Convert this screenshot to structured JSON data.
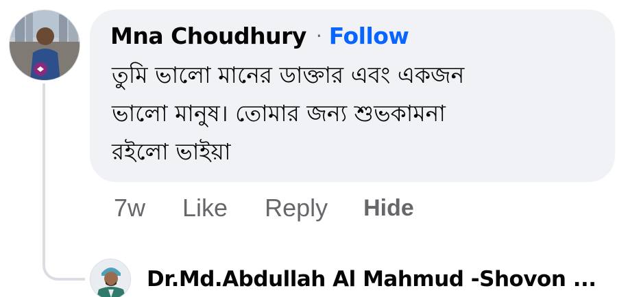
{
  "comment": {
    "author": "Mna Choudhury",
    "separator": "·",
    "follow_label": "Follow",
    "text_lines": [
      "তুমি ভালো মানের ডাক্তার এবং একজন",
      "ভালো মানুষ। তোমার জন্য শুভকামনা",
      "রইলো ভাইয়া"
    ],
    "timestamp": "7w",
    "like_label": "Like",
    "reply_label": "Reply",
    "hide_label": "Hide"
  },
  "reply": {
    "author": "Dr.Md.Abdullah Al Mahmud -Shovon ..."
  },
  "colors": {
    "bubble_bg": "#f0f2f5",
    "name": "#050505",
    "follow": "#0866ff",
    "meta": "#65676b",
    "thread_line": "#dadde1"
  }
}
